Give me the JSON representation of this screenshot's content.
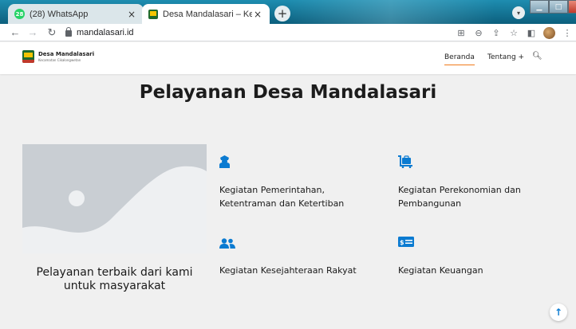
{
  "browser": {
    "tabs": [
      {
        "title": "(28) WhatsApp",
        "badge": "28"
      },
      {
        "title": "Desa Mandalasari – Kecamatan C"
      }
    ],
    "close_glyph": "×",
    "new_tab_glyph": "+",
    "url": "mandalasari.id",
    "icons": [
      "back-icon",
      "forward-icon",
      "reload-icon",
      "lock-icon",
      "translate-icon",
      "zoom-icon",
      "share-icon",
      "star-icon",
      "sidepanel-icon",
      "profile-avatar",
      "menu-icon"
    ]
  },
  "site": {
    "brand_name": "Desa Mandalasari",
    "brand_sub": "Kecamatan Cikalongwetan",
    "menu": {
      "beranda": "Beranda",
      "tentang": "Tentang +"
    },
    "accent": "#f07a1a",
    "icon_color": "#0b7bd1"
  },
  "main": {
    "title": "Pelayanan Desa Mandalasari",
    "caption": "Pelayanan terbaik dari kami untuk masyarakat",
    "services": [
      {
        "icon": "officer-icon",
        "label": "Kegiatan Pemerintahan, Ketentraman dan Ketertiban"
      },
      {
        "icon": "luggage-cart-icon",
        "label": "Kegiatan Perekonomian dan Pembangunan"
      },
      {
        "icon": "users-icon",
        "label": "Kegiatan Kesejahteraan Rakyat"
      },
      {
        "icon": "money-icon",
        "label": "Kegiatan Keuangan"
      }
    ]
  }
}
